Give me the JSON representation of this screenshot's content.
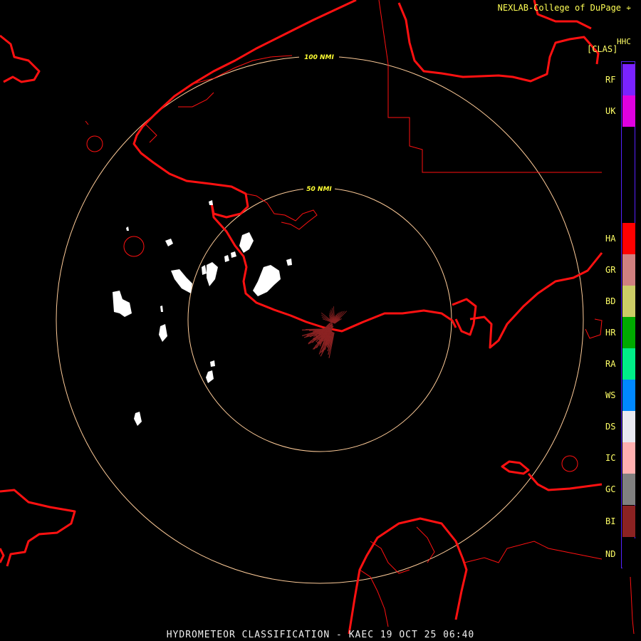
{
  "header": {
    "credit": "NEXLAB-College of DuPage ⌖"
  },
  "product": {
    "label": "HHC",
    "code": "[CLAS]"
  },
  "footer": {
    "title": "HYDROMETEOR CLASSIFICATION - KAEC 19 OCT 25 06:40"
  },
  "rings": [
    {
      "label": "50 NMI"
    },
    {
      "label": "100 NMI"
    }
  ],
  "legend": [
    {
      "code": "RF",
      "color": "#7a22ff"
    },
    {
      "code": "UK",
      "color": "#e000e0"
    },
    {
      "code": "HA",
      "color": "#ff0000"
    },
    {
      "code": "GR",
      "color": "#d08080"
    },
    {
      "code": "BD",
      "color": "#cccc66"
    },
    {
      "code": "HR",
      "color": "#00aa00"
    },
    {
      "code": "RA",
      "color": "#00ee88"
    },
    {
      "code": "WS",
      "color": "#0088ff"
    },
    {
      "code": "DS",
      "color": "#e8e8f0"
    },
    {
      "code": "IC",
      "color": "#ffb0b0"
    },
    {
      "code": "GC",
      "color": "#808080"
    },
    {
      "code": "BI",
      "color": "#8b2222"
    },
    {
      "code": "ND",
      "color": "#000000"
    }
  ],
  "colors": {
    "coast": "#ff1111",
    "rings": "#ffcc99",
    "echo": "#ffffff",
    "clutter": "#8b2222"
  }
}
